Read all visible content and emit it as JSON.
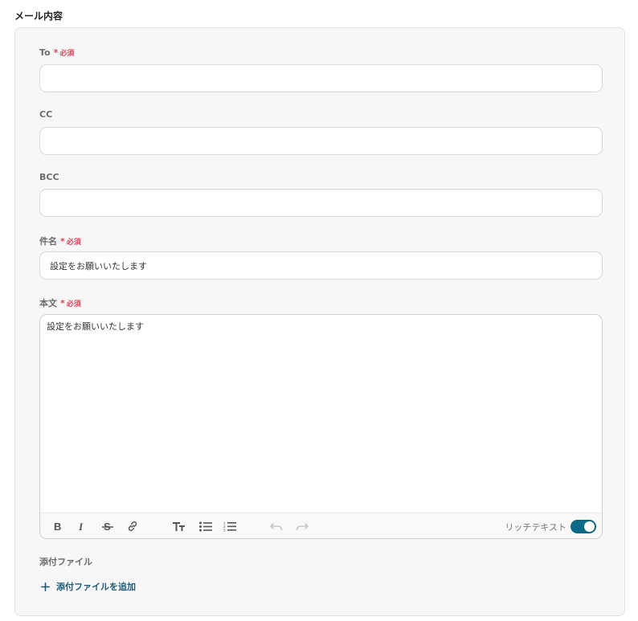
{
  "section": {
    "title": "メール内容"
  },
  "form": {
    "to": {
      "label": "To",
      "required": true,
      "value": ""
    },
    "cc": {
      "label": "CC",
      "required": false,
      "value": ""
    },
    "bcc": {
      "label": "BCC",
      "required": false,
      "value": ""
    },
    "subject": {
      "label": "件名",
      "required": true,
      "value": "設定をお願いいたします"
    },
    "body": {
      "label": "本文",
      "required": true,
      "value": "設定をお願いいたします"
    },
    "required_badge": "必須"
  },
  "editor_toolbar": {
    "buttons": [
      "bold-icon",
      "italic-icon",
      "strikethrough-icon",
      "link-icon",
      "text-size-icon",
      "bullet-list-icon",
      "numbered-list-icon",
      "undo-icon",
      "redo-icon"
    ],
    "rich_text_label": "リッチテキスト",
    "rich_text_enabled": true
  },
  "attachments": {
    "label": "添付ファイル",
    "add_label": "添付ファイルを追加"
  },
  "colors": {
    "required": "#e0455e",
    "accent": "#0d6a86",
    "link": "#1b5b78",
    "panel_bg": "#f7f7f7"
  }
}
